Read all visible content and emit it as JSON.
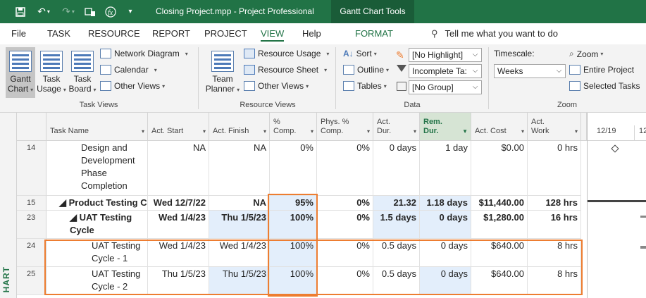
{
  "titlebar": {
    "title": "Closing Project.mpp  -  Project Professional",
    "context_tab": "Gantt Chart Tools"
  },
  "tabs": [
    {
      "label": "File"
    },
    {
      "label": "TASK"
    },
    {
      "label": "RESOURCE"
    },
    {
      "label": "REPORT"
    },
    {
      "label": "PROJECT"
    },
    {
      "label": "VIEW"
    },
    {
      "label": "Help"
    },
    {
      "label": "FORMAT"
    }
  ],
  "tell_me": "Tell me what you want to do",
  "ribbon": {
    "task_views": {
      "group_label": "Task Views",
      "gantt_chart": [
        "Gantt",
        "Chart"
      ],
      "task_usage": [
        "Task",
        "Usage"
      ],
      "task_board": [
        "Task",
        "Board"
      ],
      "network_diagram": "Network Diagram",
      "calendar": "Calendar",
      "other_views": "Other Views"
    },
    "resource_views": {
      "group_label": "Resource Views",
      "team_planner": [
        "Team",
        "Planner"
      ],
      "resource_usage": "Resource Usage",
      "resource_sheet": "Resource Sheet",
      "other_views": "Other Views"
    },
    "data": {
      "group_label": "Data",
      "sort": "Sort",
      "outline": "Outline",
      "tables": "Tables",
      "highlight": "[No Highlight]",
      "filter": "Incomplete Ta:",
      "group": "[No Group]"
    },
    "zoom": {
      "group_label": "Zoom",
      "timescale_label": "Timescale:",
      "timescale_value": "Weeks",
      "zoom": "Zoom",
      "entire_project": "Entire Project",
      "selected_tasks": "Selected Tasks"
    }
  },
  "view_bar_label": "HART",
  "table": {
    "columns": [
      {
        "label": "Task Name"
      },
      {
        "label": "Act. Start"
      },
      {
        "label": "Act. Finish"
      },
      {
        "label": [
          "%",
          "Comp."
        ]
      },
      {
        "label": [
          "Phys. %",
          "Comp."
        ]
      },
      {
        "label": [
          "Act.",
          "Dur."
        ]
      },
      {
        "label": [
          "Rem.",
          "Dur."
        ]
      },
      {
        "label": "Act. Cost"
      },
      {
        "label": [
          "Act.",
          "Work"
        ]
      }
    ],
    "rows": [
      {
        "id": "14",
        "name": "Design and Development Phase Completion",
        "act_start": "NA",
        "act_finish": "NA",
        "pct_comp": "0%",
        "phys_pct": "0%",
        "act_dur": "0 days",
        "rem_dur": "1 day",
        "act_cost": "$0.00",
        "act_work": "0 hrs"
      },
      {
        "id": "15",
        "name": "◢ Product Testing C",
        "act_start": "Wed 12/7/22",
        "act_finish": "NA",
        "pct_comp": "95%",
        "phys_pct": "0%",
        "act_dur": "21.32 days",
        "rem_dur": "1.18 days",
        "act_cost": "$11,440.00",
        "act_work": "128 hrs"
      },
      {
        "id": "23",
        "name": "◢ UAT Testing Cycle",
        "act_start": "Wed 1/4/23",
        "act_finish": "Thu 1/5/23",
        "pct_comp": "100%",
        "phys_pct": "0%",
        "act_dur": "1.5 days",
        "rem_dur": "0 days",
        "act_cost": "$1,280.00",
        "act_work": "16 hrs"
      },
      {
        "id": "24",
        "name": "UAT Testing Cycle - 1",
        "act_start": "Wed 1/4/23",
        "act_finish": "Wed 1/4/23",
        "pct_comp": "100%",
        "phys_pct": "0%",
        "act_dur": "0.5 days",
        "rem_dur": "0 days",
        "act_cost": "$640.00",
        "act_work": "8 hrs"
      },
      {
        "id": "25",
        "name": "UAT Testing Cycle - 2",
        "act_start": "Thu 1/5/23",
        "act_finish": "Thu 1/5/23",
        "pct_comp": "100%",
        "phys_pct": "0%",
        "act_dur": "0.5 days",
        "rem_dur": "0 days",
        "act_cost": "$640.00",
        "act_work": "8 hrs"
      }
    ]
  },
  "gantt": {
    "dates": [
      "12/19",
      "12"
    ]
  },
  "colors": {
    "brand": "#217346",
    "highlight_outline": "#ed7d31",
    "edited_cell": "#e3eefb"
  }
}
